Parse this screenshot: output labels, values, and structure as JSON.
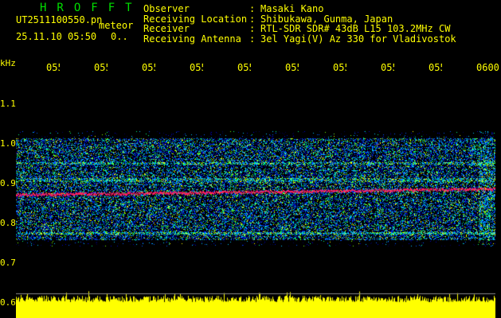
{
  "app_title": "HROFFT",
  "file": {
    "name": "UT2511100550.pn",
    "mode": "meteor",
    "datetime": "25.11.10 05:50",
    "count": "0.."
  },
  "info": [
    {
      "label": "Observer",
      "value": "Masaki Kano"
    },
    {
      "label": "Receiving Location",
      "value": "Shibukawa, Gunma, Japan"
    },
    {
      "label": "Receiver",
      "value": "RTL-SDR SDR# 43dB L15 103.2MHz CW"
    },
    {
      "label": "Receiving Antenna",
      "value": "3el Yagi(V) Az 330 for Vladivostok"
    }
  ],
  "y_unit": "kHz",
  "y_ticks": [
    "1.1",
    "1.0",
    "0.9",
    "0.8",
    "0.7",
    "0.6"
  ],
  "x_ticks": [
    "0551",
    "0552",
    "0553",
    "0554",
    "0555",
    "0556",
    "0557",
    "0558",
    "0559",
    "0600"
  ],
  "colors": {
    "text": "#ffff00",
    "title": "#00e000",
    "signal": "#ff2060",
    "noise": "#ffff00"
  }
}
